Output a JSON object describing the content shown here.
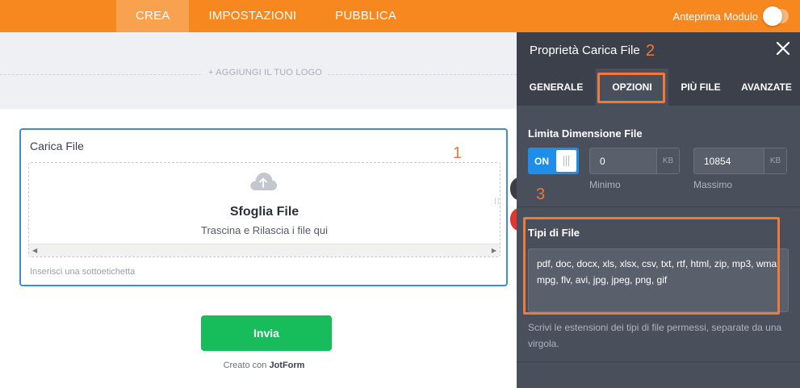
{
  "topbar": {
    "tabs": [
      {
        "label": "CREA",
        "active": true
      },
      {
        "label": "IMPOSTAZIONI",
        "active": false
      },
      {
        "label": "PUBBLICA",
        "active": false
      }
    ],
    "preview_label": "Anteprima Modulo",
    "preview_enabled": false
  },
  "logo": {
    "add_label": "+ AGGIUNGI IL TUO LOGO"
  },
  "form": {
    "field_label": "Carica File",
    "badge_1": "1",
    "drop_title": "Sfoglia File",
    "drop_subtitle": "Trascina e Rilascia i file qui",
    "sublabel_placeholder": "Inserisci una sottoetichetta",
    "submit_label": "Invia",
    "credit_prefix": "Creato con",
    "credit_brand": "JotForm"
  },
  "panel": {
    "title": "Proprietà Carica File",
    "badge_2": "2",
    "tabs": [
      {
        "label": "GENERALE",
        "active": false
      },
      {
        "label": "OPZIONI",
        "active": true
      },
      {
        "label": "PIÙ FILE",
        "active": false
      },
      {
        "label": "AVANZATE",
        "active": false
      }
    ],
    "limit_title": "Limita Dimensione File",
    "limit_toggle_label": "ON",
    "min_value": "0",
    "min_unit": "KB",
    "min_caption": "Minimo",
    "max_value": "10854",
    "max_unit": "KB",
    "max_caption": "Massimo",
    "badge_3": "3",
    "types_title": "Tipi di File",
    "types_value": "pdf, doc, docx, xls, xlsx, csv, txt, rtf, html, zip, mp3, wma, mpg, flv, avi, jpg, jpeg, png, gif",
    "types_hint": "Scrivi le estensioni dei tipi di file permessi, separate da una virgola."
  },
  "colors": {
    "topbar": "#f7881f",
    "panel": "#4a4f5c",
    "accent_blue": "#3f8bd9",
    "submit_green": "#18bd5b",
    "annotation_orange": "#f07a3c"
  },
  "icons": [
    "cloud-upload-icon",
    "close-icon",
    "drag-handle-icon"
  ]
}
